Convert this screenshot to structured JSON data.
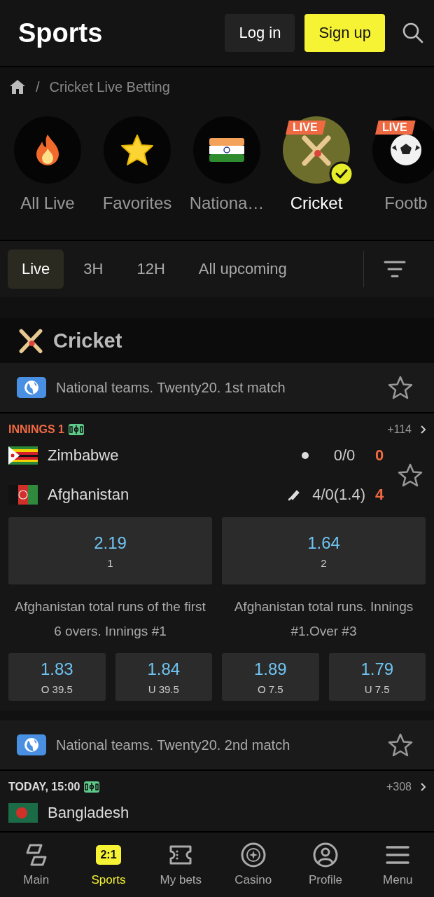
{
  "header": {
    "title": "Sports",
    "login": "Log in",
    "signup": "Sign up"
  },
  "breadcrumb": {
    "separator": "/",
    "items": [
      "Cricket Live Betting"
    ]
  },
  "categories": [
    {
      "label": "All Live",
      "kind": "fire",
      "selected": false
    },
    {
      "label": "Favorites",
      "kind": "star",
      "selected": false
    },
    {
      "label": "Nationa…",
      "kind": "flag",
      "selected": false
    },
    {
      "label": "Cricket",
      "kind": "cricket",
      "badge": "LIVE",
      "selected": true
    },
    {
      "label": "Footb",
      "kind": "ball",
      "badge": "LIVE",
      "selected": false
    }
  ],
  "periods": [
    {
      "label": "Live",
      "selected": true
    },
    {
      "label": "3H",
      "selected": false
    },
    {
      "label": "12H",
      "selected": false
    },
    {
      "label": "All upcoming",
      "selected": false
    }
  ],
  "section": {
    "title": "Cricket"
  },
  "leagues": [
    {
      "name": "National teams. Twenty20. 1st match",
      "status": "INNINGS 1",
      "live": true,
      "more": "+114",
      "teams": [
        {
          "name": "Zimbabwe",
          "kind": "zimbabwe",
          "batting": false,
          "detail": "0/0",
          "score": "0"
        },
        {
          "name": "Afghanistan",
          "kind": "afghanistan",
          "batting": true,
          "detail": "4/0(1.4)",
          "score": "4"
        }
      ],
      "main_odds": [
        {
          "value": "2.19",
          "label": "1"
        },
        {
          "value": "1.64",
          "label": "2"
        }
      ],
      "markets": [
        {
          "title": "Afghanistan total runs of the first 6 overs. Innings #1",
          "odds": [
            {
              "value": "1.83",
              "label": "O 39.5"
            },
            {
              "value": "1.84",
              "label": "U 39.5"
            }
          ]
        },
        {
          "title": "Afghanistan total runs. Innings #1.Over #3",
          "odds": [
            {
              "value": "1.89",
              "label": "O 7.5"
            },
            {
              "value": "1.79",
              "label": "U 7.5"
            }
          ]
        }
      ]
    },
    {
      "name": "National teams. Twenty20. 2nd match",
      "status": "TODAY, 15:00",
      "live": false,
      "more": "+308",
      "teams": [
        {
          "name": "Bangladesh",
          "kind": "bangladesh"
        }
      ]
    }
  ],
  "nav": [
    {
      "label": "Main",
      "kind": "main",
      "selected": false
    },
    {
      "label": "Sports",
      "kind": "score",
      "badge": "2:1",
      "selected": true
    },
    {
      "label": "My bets",
      "kind": "ticket",
      "selected": false
    },
    {
      "label": "Casino",
      "kind": "chip",
      "selected": false
    },
    {
      "label": "Profile",
      "kind": "profile",
      "selected": false
    },
    {
      "label": "Menu",
      "kind": "menu",
      "selected": false
    }
  ]
}
